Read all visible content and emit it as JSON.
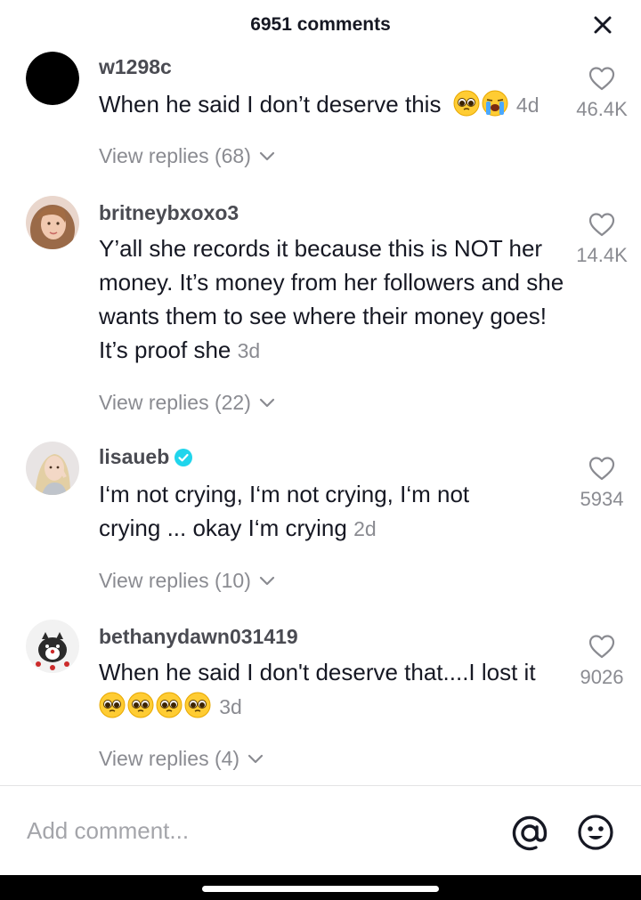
{
  "header": {
    "title": "6951 comments",
    "close_icon": "close-icon"
  },
  "comments": [
    {
      "username": "w1298c",
      "verified": false,
      "text": "When he said I don’t deserve this",
      "emojis": [
        "pleading-face-emoji",
        "loudly-crying-face-emoji"
      ],
      "time": "4d",
      "likes": "46.4K",
      "replies": "View replies (68)"
    },
    {
      "username": "britneybxoxo3",
      "verified": false,
      "text": "Y’all she records it because this is NOT her money. It’s money from her followers and she wants them to see where their money goes! It’s proof she",
      "emojis": [],
      "time": "3d",
      "likes": "14.4K",
      "replies": "View replies (22)"
    },
    {
      "username": "lisaueb",
      "verified": true,
      "text": "I‘m not crying, I‘m not crying, I‘m not crying ... okay I‘m crying",
      "emojis": [],
      "time": "2d",
      "likes": "5934",
      "replies": "View replies (10)"
    },
    {
      "username": "bethanydawn031419",
      "verified": false,
      "text": "When he said I don't deserve that....I lost it",
      "emojis": [
        "pleading-face-emoji",
        "pleading-face-emoji",
        "pleading-face-emoji",
        "pleading-face-emoji"
      ],
      "time": "3d",
      "likes": "9026",
      "replies": "View replies (4)"
    }
  ],
  "input_bar": {
    "placeholder": "Add comment...",
    "mention_icon": "at-sign-icon",
    "emoji_icon": "smiley-face-icon"
  },
  "colors": {
    "text_primary": "#161823",
    "text_secondary": "#8a8b91",
    "verified_badge": "#20d5ec"
  }
}
